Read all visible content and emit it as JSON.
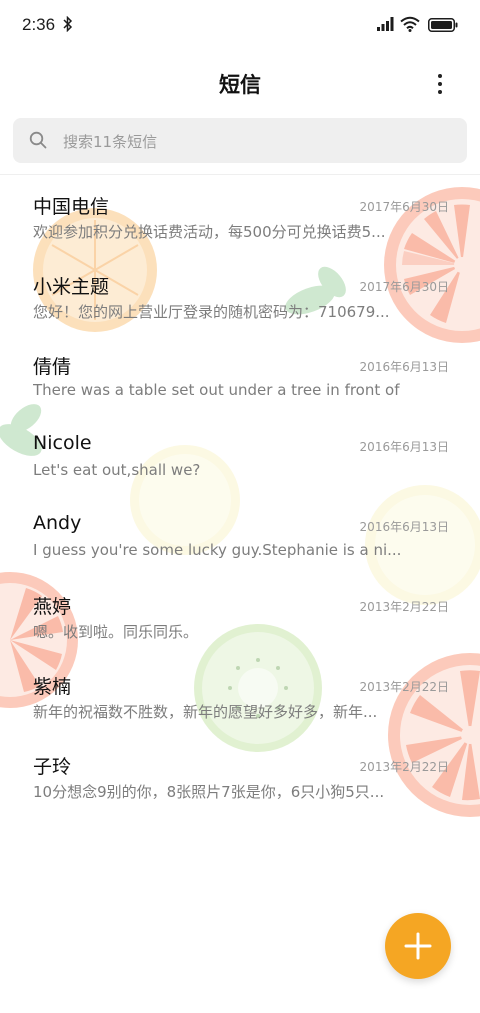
{
  "status_bar": {
    "time": "2:36"
  },
  "header": {
    "title": "短信"
  },
  "search": {
    "placeholder": "搜索11条短信"
  },
  "messages": [
    {
      "name": "中国电信",
      "date": "2017年6月30日",
      "preview": "欢迎参加积分兑换话费活动，每500分可兑换话费5..."
    },
    {
      "name": "小米主题",
      "date": "2017年6月30日",
      "preview": "您好！您的网上营业厅登录的随机密码为：710679..."
    },
    {
      "name": "倩倩",
      "date": "2016年6月13日",
      "preview": "There was a table set out under a tree in front of ..."
    },
    {
      "name": "Nicole",
      "date": "2016年6月13日",
      "preview": "Let's eat out,shall we?"
    },
    {
      "name": "Andy",
      "date": "2016年6月13日",
      "preview": "I guess you're some lucky guy.Stephanie is a ni..."
    },
    {
      "name": "燕婷",
      "date": "2013年2月22日",
      "preview": "嗯。收到啦。同乐同乐。"
    },
    {
      "name": "紫楠",
      "date": "2013年2月22日",
      "preview": "新年的祝福数不胜数，新年的愿望好多好多，新年..."
    },
    {
      "name": "子玲",
      "date": "2013年2月22日",
      "preview": "10分想念9别的你，8张照片7张是你，6只小狗5只..."
    }
  ],
  "colors": {
    "fab": "#f5a623",
    "grapefruit": "#f7a08a",
    "kiwi": "#cfe6b4"
  },
  "icons": {
    "status": [
      "bluetooth-icon",
      "signal-icon",
      "wifi-icon",
      "battery-icon"
    ],
    "header": "more-vertical-icon",
    "search": "search-icon",
    "fab": "plus-icon"
  }
}
